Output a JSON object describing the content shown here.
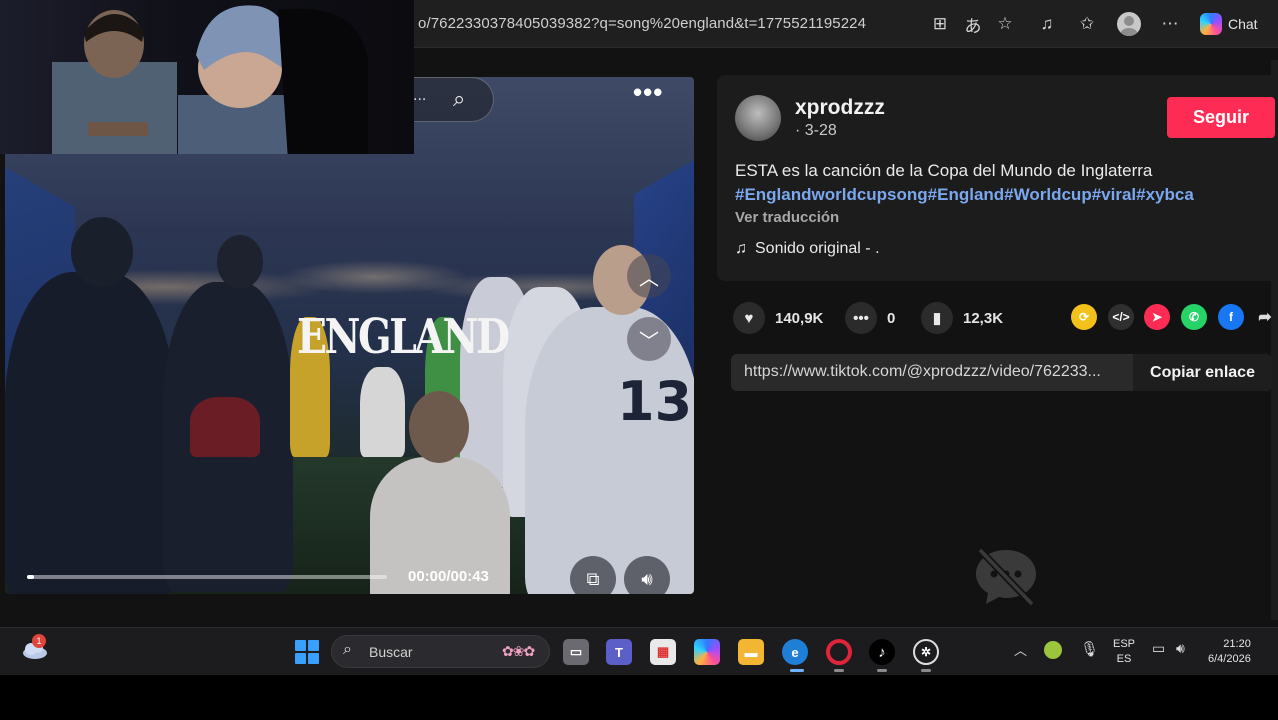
{
  "browser": {
    "url": "o/7622330378405039382?q=song%20england&t=1775521195224",
    "chat_label": "Chat"
  },
  "video": {
    "overlay_text": "ENGLAND",
    "jersey_number": "13",
    "search_dots": "...",
    "more_dots": "•••",
    "time": "00:00/00:43",
    "progress_fraction": 0.02
  },
  "post": {
    "author": "xprodzzz",
    "meta": "· 3-28",
    "follow_label": "Seguir",
    "description": "ESTA es la canción de la Copa del Mundo de Inglaterra",
    "hashtags": "#Englandworldcupsong#England#Worldcup#viral#xybca",
    "translate_label": "Ver traducción",
    "sound": "Sonido original - ."
  },
  "stats": {
    "likes": "140,9K",
    "comments": "0",
    "saves": "12,3K"
  },
  "share": {
    "link": "https://www.tiktok.com/@xprodzzz/video/762233...",
    "copy_label": "Copiar enlace",
    "embed_glyph": "</>"
  },
  "taskbar": {
    "search_placeholder": "Buscar",
    "weather_badge": "1",
    "lang_top": "ESP",
    "lang_bottom": "ES",
    "time": "21:20",
    "date": "6/4/2026"
  },
  "colors": {
    "follow": "#fe2c55",
    "hashtag": "#7aa7ee",
    "edge": "#1f7fd6",
    "opera": "#e0243a"
  }
}
